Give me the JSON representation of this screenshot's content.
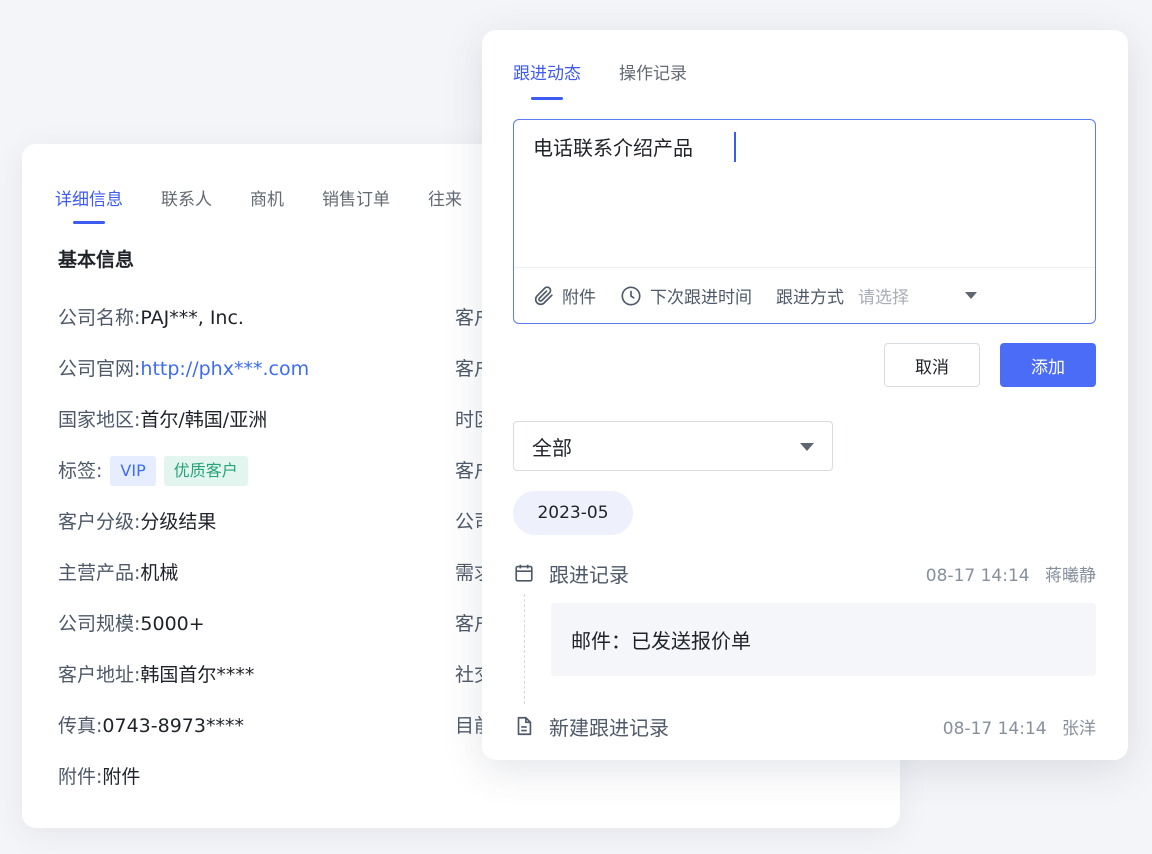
{
  "customer_detail": {
    "tabs": [
      {
        "label": "详细信息",
        "active": true
      },
      {
        "label": "联系人",
        "active": false
      },
      {
        "label": "商机",
        "active": false
      },
      {
        "label": "销售订单",
        "active": false
      },
      {
        "label": "往来",
        "active": false
      }
    ],
    "section_title": "基本信息",
    "fields": {
      "company_name": {
        "label": "公司名称: ",
        "value": "PAJ***, Inc."
      },
      "website": {
        "label": "公司官网: ",
        "value": "http://phx***.com"
      },
      "region": {
        "label": "国家地区: ",
        "value": "首尔/韩国/亚洲"
      },
      "tags": {
        "label": "标签: ",
        "items": [
          "VIP",
          "优质客户"
        ]
      },
      "grade": {
        "label": "客户分级: ",
        "value": "分级结果"
      },
      "main_product": {
        "label": "主营产品: ",
        "value": "机械"
      },
      "scale": {
        "label": "公司规模: ",
        "value": "5000+"
      },
      "address": {
        "label": "客户地址: ",
        "value": "韩国首尔****"
      },
      "fax": {
        "label": "传真: ",
        "value": "0743-8973****"
      },
      "attachment": {
        "label": "附件: ",
        "value": "附件"
      }
    },
    "right_column_labels": [
      "客户",
      "客户",
      "时区",
      "客户",
      "公司",
      "需求",
      "客户",
      "社交",
      "目前"
    ]
  },
  "followup_panel": {
    "tabs": [
      {
        "label": "跟进动态",
        "active": true
      },
      {
        "label": "操作记录",
        "active": false
      }
    ],
    "editor": {
      "content": "电话联系介绍产品",
      "toolbar": {
        "attachment_label": "附件",
        "next_time_label": "下次跟进时间",
        "method_label": "跟进方式",
        "method_placeholder": "请选择"
      }
    },
    "cancel_label": "取消",
    "add_label": "添加",
    "filter": {
      "selected": "全部"
    },
    "date_group": "2023-05",
    "timeline": [
      {
        "icon": "calendar-icon",
        "title": "跟进记录",
        "time": "08-17 14:14",
        "user": "蒋曦静",
        "content": "邮件：已发送报价单"
      },
      {
        "icon": "document-icon",
        "title": "新建跟进记录",
        "time": "08-17 14:14",
        "user": "张洋"
      }
    ]
  },
  "colors": {
    "accent": "#3d5af1",
    "primary_button": "#4a6cf7",
    "tag_vip_bg": "#e6edfe",
    "tag_good_bg": "#e2f6ef",
    "tag_good_text": "#27a27a"
  }
}
